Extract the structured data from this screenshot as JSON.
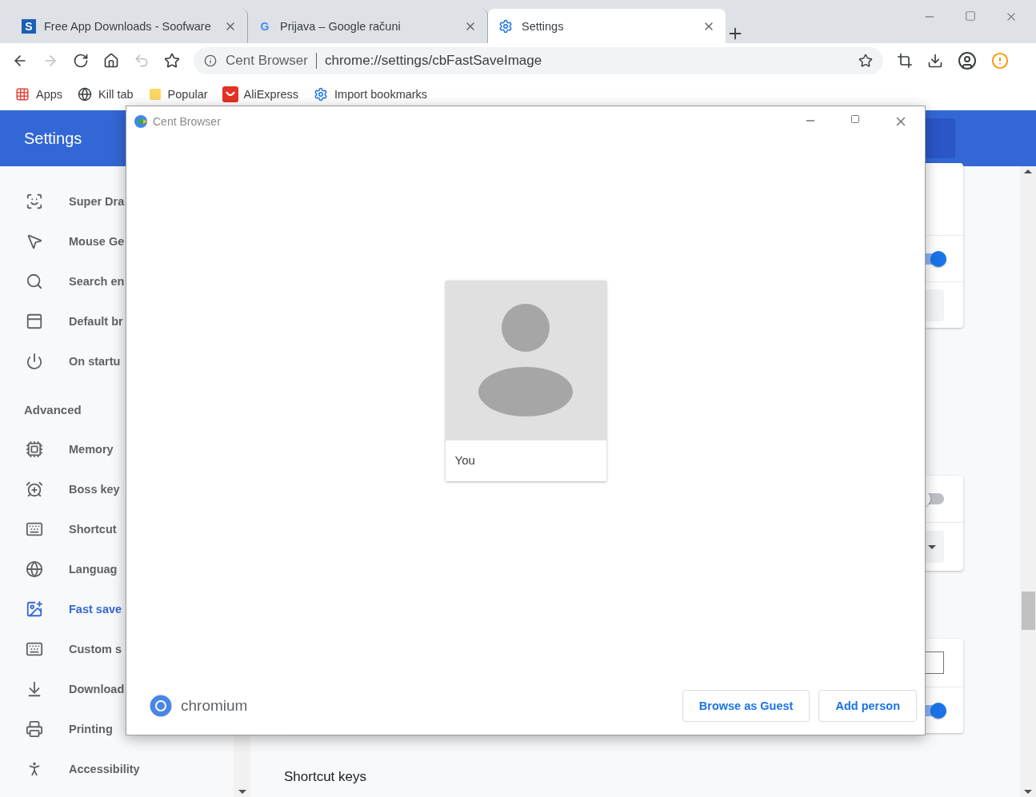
{
  "tabs": [
    {
      "title": "Free App Downloads - Soofware",
      "selected": false,
      "favicon_text": "S"
    },
    {
      "title": "Prijava – Google računi",
      "selected": false,
      "favicon_text": "G"
    },
    {
      "title": "Settings",
      "selected": true
    }
  ],
  "toolbar": {
    "forward_disabled": true,
    "undo_disabled": true
  },
  "omnibox": {
    "site_label": "Cent Browser",
    "url": "chrome://settings/cbFastSaveImage"
  },
  "bookmarks": [
    "Apps",
    "Kill tab",
    "Popular",
    "AliExpress",
    "Import bookmarks"
  ],
  "settings": {
    "title": "Settings",
    "sidebar": {
      "basic": [
        {
          "label": "Super Dra",
          "selected": false
        },
        {
          "label": "Mouse Ge",
          "selected": false
        },
        {
          "label": "Search en",
          "selected": false
        },
        {
          "label": "Default br",
          "selected": false
        },
        {
          "label": "On startu",
          "selected": false
        }
      ],
      "advanced_heading": "Advanced",
      "advanced": [
        {
          "label": "Memory",
          "selected": false
        },
        {
          "label": "Boss key",
          "selected": false
        },
        {
          "label": "Shortcut",
          "selected": false
        },
        {
          "label": "Languag",
          "selected": false
        },
        {
          "label": "Fast save",
          "selected": true
        },
        {
          "label": "Custom s",
          "selected": false
        },
        {
          "label": "Download",
          "selected": false
        },
        {
          "label": "Printing",
          "selected": false
        },
        {
          "label": "Accessibility",
          "selected": false
        }
      ]
    },
    "cards": [
      {
        "rows": [
          {
            "kind": "blank"
          },
          {
            "kind": "toggle",
            "on": true
          },
          {
            "kind": "button"
          }
        ]
      },
      {
        "rows": [
          {
            "kind": "toggle",
            "on": false
          },
          {
            "kind": "dropdown"
          }
        ]
      },
      {
        "rows": [
          {
            "kind": "input"
          },
          {
            "kind": "toggle",
            "on": true
          }
        ]
      }
    ],
    "section_heading": "Shortcut keys"
  },
  "dialog": {
    "title": "Cent Browser",
    "profiles": [
      {
        "name": "You"
      }
    ],
    "brand": "chromium",
    "buttons": [
      "Browse as Guest",
      "Add person"
    ]
  }
}
